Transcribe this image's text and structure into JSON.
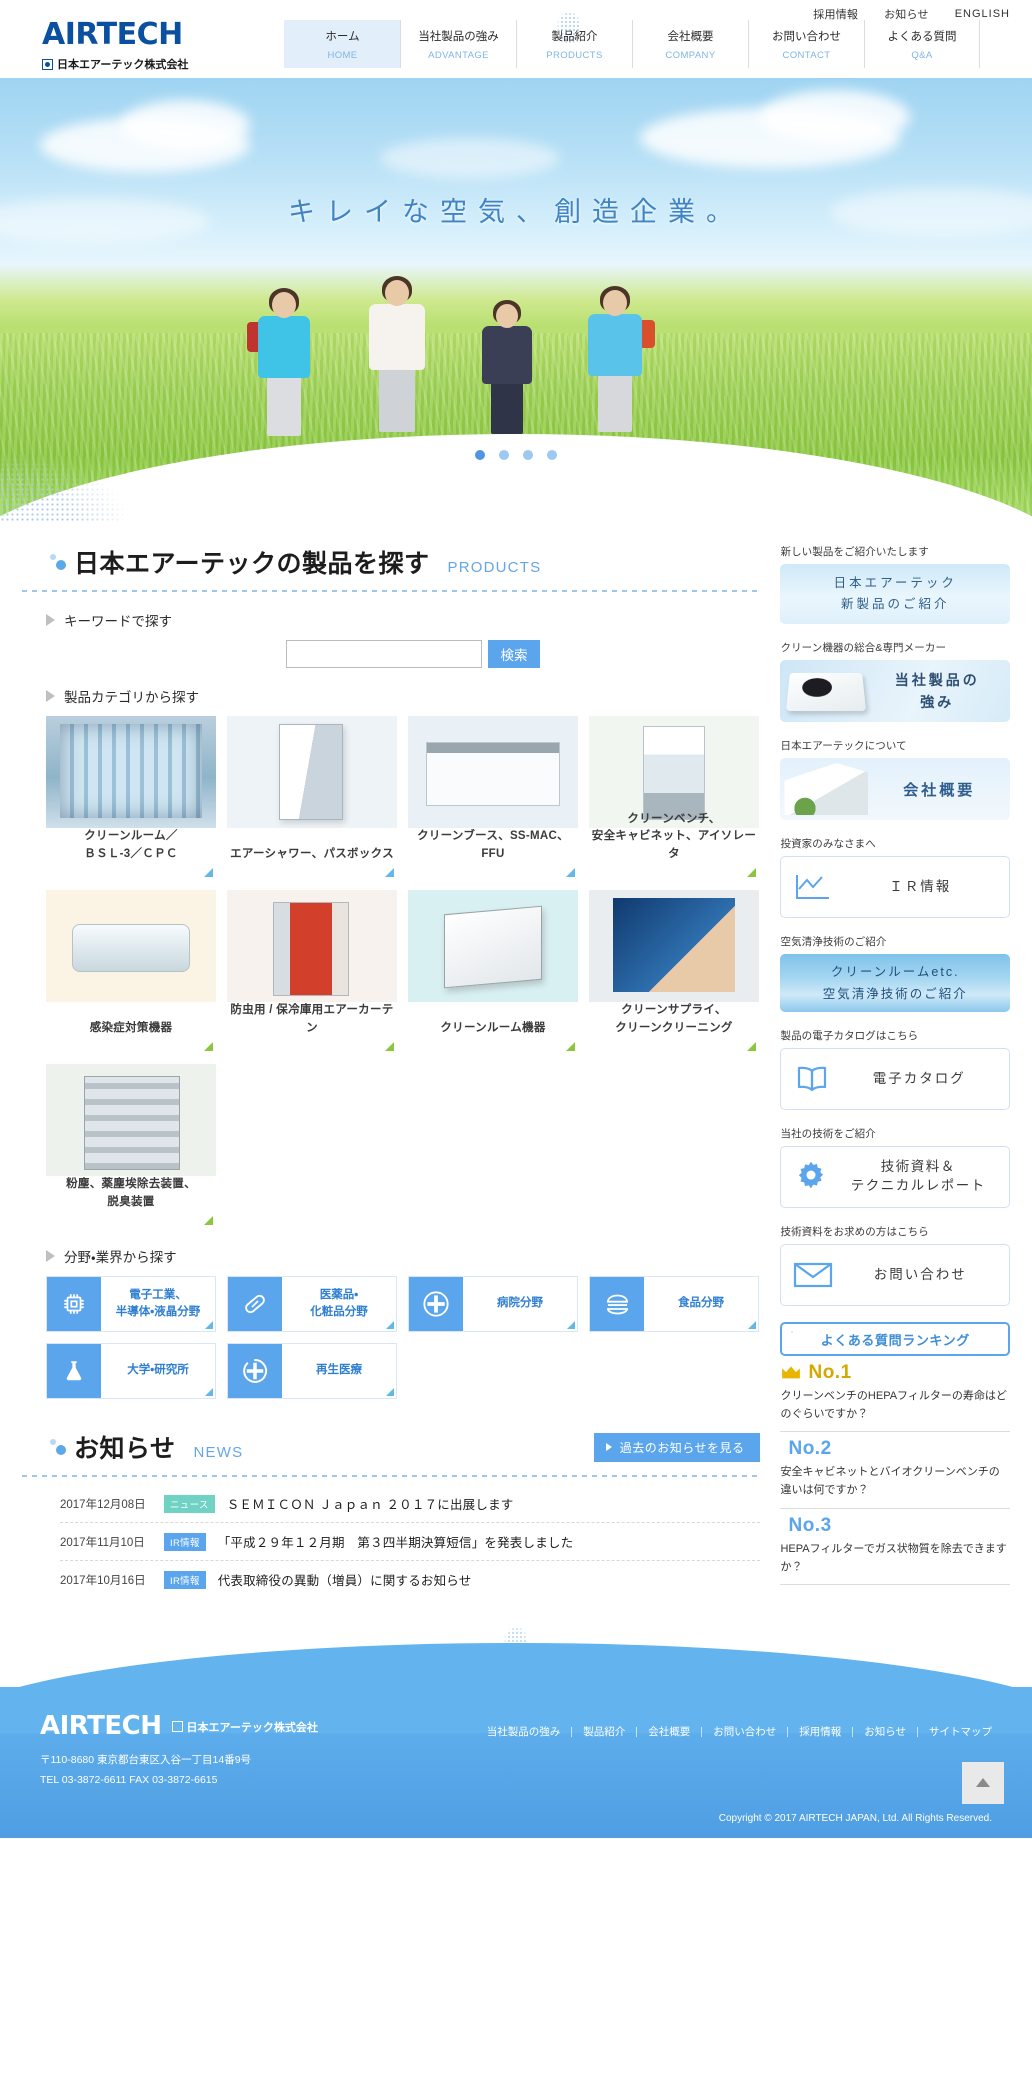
{
  "header": {
    "logo": {
      "wordmark": "AIRTECH",
      "company": "日本エアーテック株式会社"
    },
    "utility_links": [
      "採用情報",
      "お知らせ",
      "ENGLISH"
    ],
    "nav": [
      {
        "ja": "ホーム",
        "en": "HOME",
        "active": true
      },
      {
        "ja": "当社製品の強み",
        "en": "ADVANTAGE",
        "active": false
      },
      {
        "ja": "製品紹介",
        "en": "PRODUCTS",
        "active": false
      },
      {
        "ja": "会社概要",
        "en": "COMPANY",
        "active": false
      },
      {
        "ja": "お問い合わせ",
        "en": "CONTACT",
        "active": false
      },
      {
        "ja": "よくある質問",
        "en": "Q&A",
        "active": false
      }
    ]
  },
  "hero": {
    "catchcopy": "キレイな空気、創造企業。",
    "slides_total": 4,
    "active_slide": 1
  },
  "products": {
    "title": "日本エアーテックの製品を探す",
    "title_en": "PRODUCTS",
    "keyword_label": "キーワードで探す",
    "keyword_value": "",
    "keyword_placeholder": "",
    "search_button": "検索",
    "category_label": "製品カテゴリから探す",
    "categories": [
      {
        "label": "クリーンルーム／\nＢＳＬ-3／ＣＰＣ",
        "thumb": "t-cleanroom",
        "corner": "blue"
      },
      {
        "label": "エアーシャワー、パスボックス",
        "thumb": "t-airshower",
        "corner": "blue"
      },
      {
        "label": "クリーンブース、SS-MAC、FFU",
        "thumb": "t-booth",
        "corner": "blue"
      },
      {
        "label": "クリーンベンチ、\n安全キャビネット、アイソレータ",
        "thumb": "t-bench",
        "corner": "green"
      },
      {
        "label": "感染症対策機器",
        "thumb": "t-isolator",
        "corner": "green"
      },
      {
        "label": "防虫用 / 保冷庫用エアーカーテン",
        "thumb": "t-curtain",
        "corner": "green"
      },
      {
        "label": "クリーンルーム機器",
        "thumb": "t-equip",
        "corner": "green"
      },
      {
        "label": "クリーンサプライ、\nクリーンクリーニング",
        "thumb": "t-supply",
        "corner": "green"
      },
      {
        "label": "粉塵、薬塵埃除去装置、\n脱臭装置",
        "thumb": "t-dust",
        "corner": "green"
      }
    ],
    "field_label": "分野・業界から探す",
    "fields": [
      {
        "label": "電子工業、\n半導体・液晶分野",
        "icon": "chip-icon"
      },
      {
        "label": "医薬品・\n化粧品分野",
        "icon": "capsule-icon"
      },
      {
        "label": "病院分野",
        "icon": "plus-cross-icon"
      },
      {
        "label": "食品分野",
        "icon": "burger-icon"
      },
      {
        "label": "大学・研究所",
        "icon": "flask-icon"
      },
      {
        "label": "再生医療",
        "icon": "regeneration-icon"
      }
    ]
  },
  "news": {
    "title": "お知らせ",
    "title_en": "NEWS",
    "more_label": "過去のお知らせを見る",
    "items": [
      {
        "date": "2017年12月08日",
        "tag": "ニュース",
        "tag_type": "news",
        "text": "ＳＥＭＩＣＯＮ Ｊａｐａｎ ２０１７に出展します"
      },
      {
        "date": "2017年11月10日",
        "tag": "IR情報",
        "tag_type": "ir",
        "text": "「平成２９年１２月期　第３四半期決算短信」を発表しました"
      },
      {
        "date": "2017年10月16日",
        "tag": "IR情報",
        "tag_type": "ir",
        "text": "代表取締役の異動（増員）に関するお知らせ"
      }
    ]
  },
  "sidebar": {
    "blocks": [
      {
        "caption": "新しい製品をご紹介いたします",
        "kind": "banner-new",
        "label_line1": "日本エアーテック",
        "label_line2": "新製品のご紹介"
      },
      {
        "caption": "クリーン機器の総合&専門メーカー",
        "kind": "banner-strength",
        "label_line1": "当社製品の",
        "label_line2": "強み"
      },
      {
        "caption": "日本エアーテックについて",
        "kind": "banner-company",
        "label_line1": "会社概要"
      },
      {
        "caption": "投資家のみなさまへ",
        "kind": "btn-ir",
        "label_line1": "ＩＲ情報",
        "icon": "chart-line-icon"
      },
      {
        "caption": "空気清浄技術のご紹介",
        "kind": "banner-air",
        "label_line1": "クリーンルームetc.",
        "label_line2": "空気清浄技術のご紹介"
      },
      {
        "caption": "製品の電子カタログはこちら",
        "kind": "btn-catalog",
        "label_line1": "電子カタログ",
        "icon": "book-icon"
      },
      {
        "caption": "当社の技術をご紹介",
        "kind": "btn-tech",
        "label_line1": "技術資料＆",
        "label_line2": "テクニカルレポート",
        "icon": "gear-icon"
      },
      {
        "caption": "技術資料をお求めの方はこちら",
        "kind": "btn-contact",
        "label_line1": "お問い合わせ",
        "icon": "mail-icon"
      }
    ],
    "faq": {
      "heading": "よくある質問ランキング",
      "items": [
        {
          "rank": "No.1",
          "crown": true,
          "question": "クリーンベンチのHEPAフィルターの寿命はどのぐらいですか？"
        },
        {
          "rank": "No.2",
          "crown": false,
          "question": "安全キャビネットとバイオクリーンベンチの違いは何ですか？"
        },
        {
          "rank": "No.3",
          "crown": false,
          "question": "HEPAフィルターでガス状物質を除去できますか？"
        }
      ]
    }
  },
  "footer": {
    "logo": {
      "wordmark": "AIRTECH",
      "company": "日本エアーテック株式会社"
    },
    "address": "〒110-8680 東京都台東区入谷一丁目14番9号",
    "tel": "TEL 03-3872-6611 FAX 03-3872-6615",
    "links": [
      "当社製品の強み",
      "製品紹介",
      "会社概要",
      "お問い合わせ",
      "採用情報",
      "お知らせ",
      "サイトマップ"
    ],
    "copyright": "Copyright © 2017 AIRTECH JAPAN, Ltd. All Rights Reserved."
  },
  "colors": {
    "brand_blue": "#0a4fa0",
    "accent_blue": "#5aa5ec",
    "light_blue": "#e2effb",
    "news_tag": "#6fd2c4",
    "ir_tag": "#5aa5ec",
    "crown_gold": "#d4a800"
  }
}
